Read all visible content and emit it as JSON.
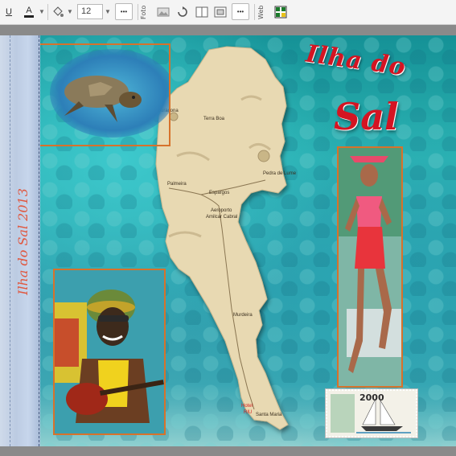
{
  "toolbar": {
    "underline_label": "U",
    "text_color_label": "A",
    "font_size": "12",
    "more_label": "•••",
    "more2_label": "•••",
    "group_photo": "Foto",
    "group_web": "Web"
  },
  "page": {
    "title_line1": "Ilha do",
    "title_line2": "Sal",
    "spine_text": "Ilha do Sal 2013",
    "stamp_year": "2000",
    "map_labels": {
      "buracona": "Buracona",
      "terra_boa": "Terra Boa",
      "pedra_de_lume": "Pedra de Lume",
      "palmeira": "Palmeira",
      "espargos": "Espargos",
      "aeroporto": "Aeroporto",
      "amilcar_cabral": "Amilcar Cabral",
      "murdeira": "Murdeira",
      "hotel": "Hotel",
      "riu": "RIU",
      "santa_maria": "Santa Maria"
    }
  },
  "colors": {
    "title_red": "#d41422",
    "frame_orange": "#d7722b",
    "sea": "#2bb3b3",
    "island": "#e8d9b2"
  }
}
